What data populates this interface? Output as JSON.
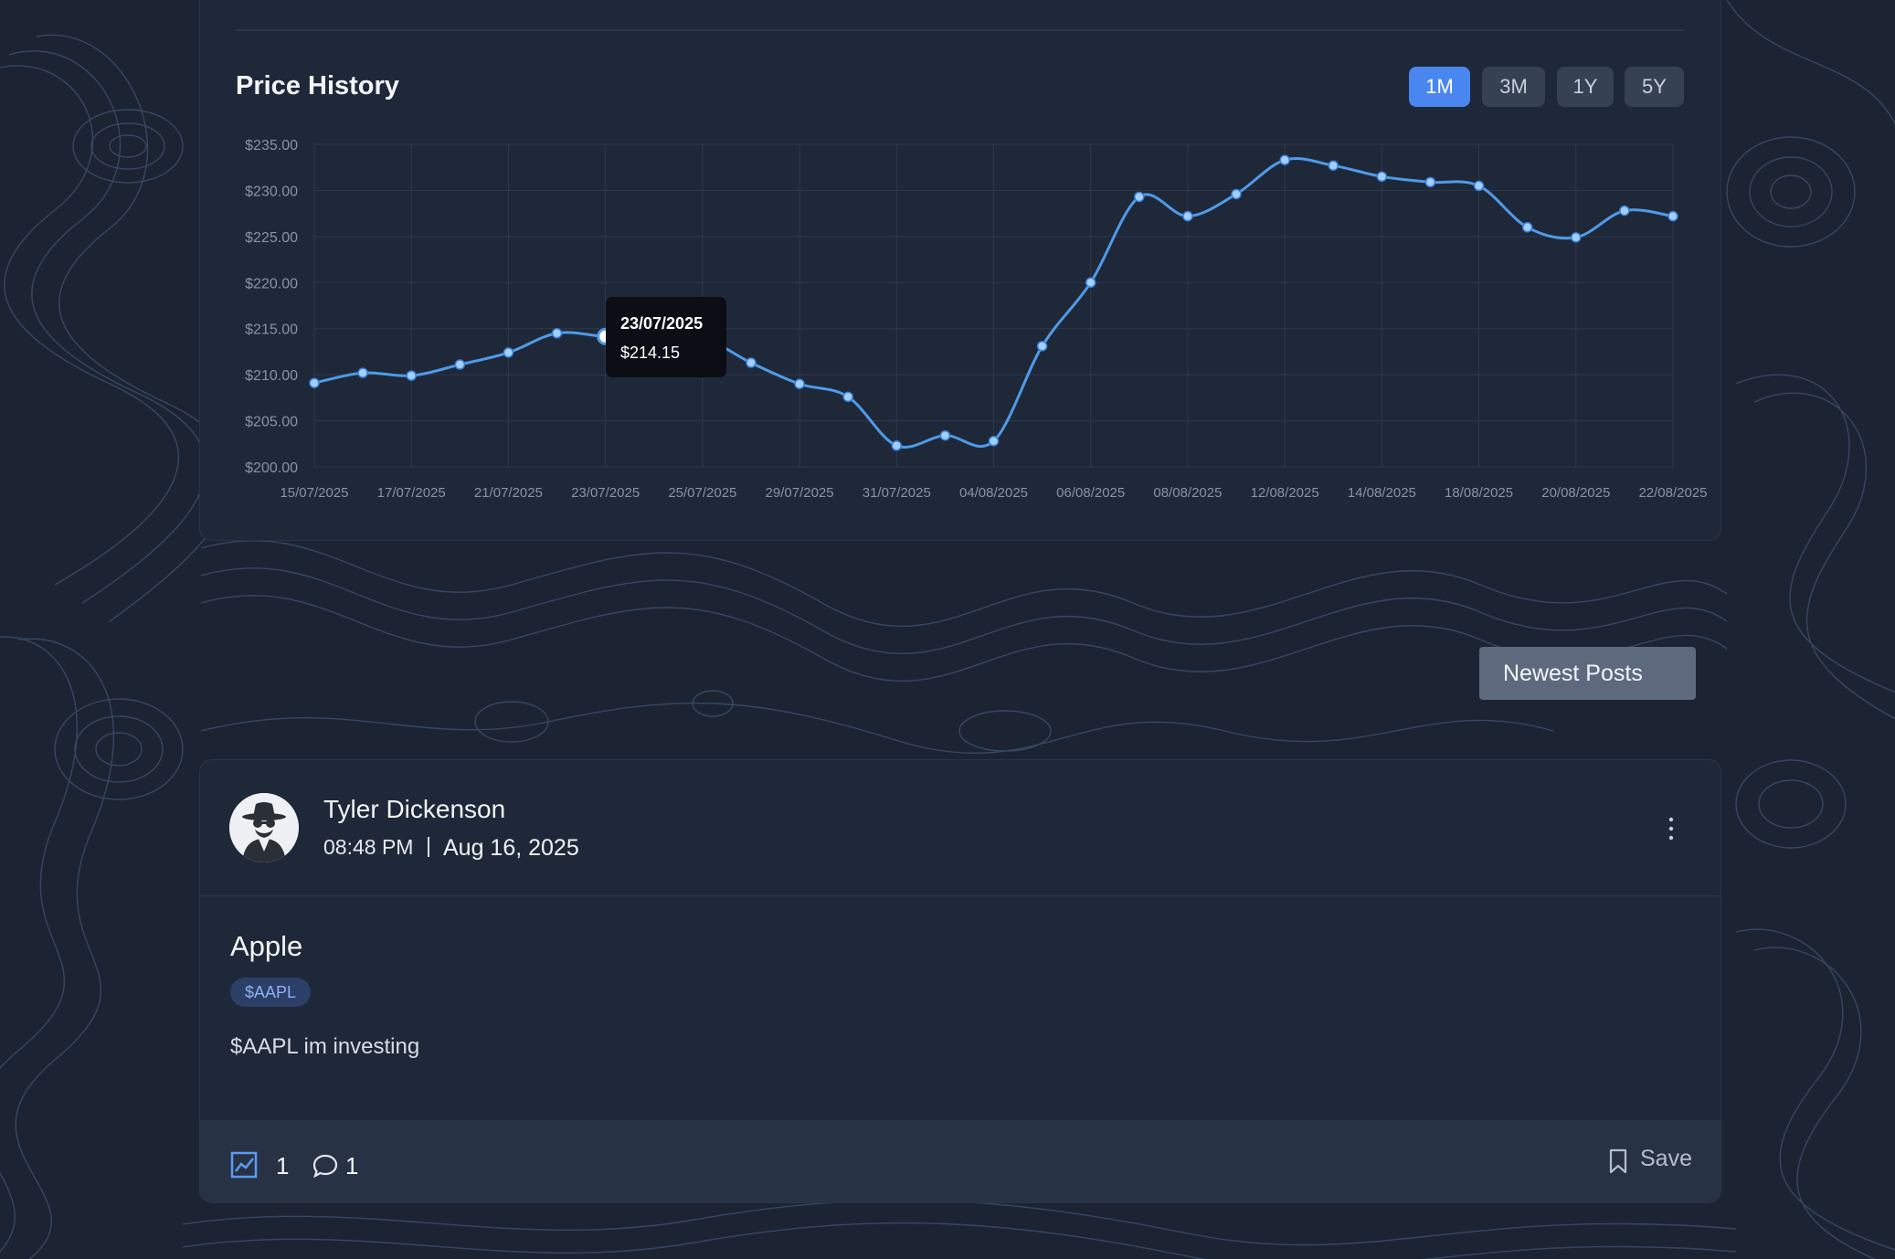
{
  "chart_card": {
    "title": "Price History",
    "ranges": [
      "1M",
      "3M",
      "1Y",
      "5Y"
    ],
    "active_range": "1M",
    "tooltip": {
      "date": "23/07/2025",
      "price": "$214.15"
    }
  },
  "chart_data": {
    "type": "line",
    "y_ticks": [
      "$235.00",
      "$230.00",
      "$225.00",
      "$220.00",
      "$215.00",
      "$210.00",
      "$205.00",
      "$200.00"
    ],
    "x_tick_labels": [
      "15/07/2025",
      "17/07/2025",
      "21/07/2025",
      "23/07/2025",
      "25/07/2025",
      "29/07/2025",
      "31/07/2025",
      "04/08/2025",
      "06/08/2025",
      "08/08/2025",
      "12/08/2025",
      "14/08/2025",
      "18/08/2025",
      "20/08/2025",
      "22/08/2025"
    ],
    "ylim": [
      200,
      235
    ],
    "values": [
      209.1,
      210.2,
      209.9,
      211.1,
      212.4,
      214.5,
      214.15,
      214.0,
      214.0,
      211.3,
      209.0,
      207.6,
      202.3,
      203.4,
      202.8,
      213.1,
      220.0,
      229.3,
      227.2,
      229.6,
      233.3,
      232.7,
      231.5,
      230.9,
      230.5,
      226.0,
      224.9,
      227.8,
      227.2
    ],
    "line_color": "#4f9be8",
    "grid": true
  },
  "sort_button": {
    "label": "Newest Posts"
  },
  "post": {
    "author": "Tyler Dickenson",
    "time": "08:48 PM",
    "separator": "|",
    "date": "Aug 16, 2025",
    "title": "Apple",
    "ticker": "$AAPL",
    "body": "$AAPL im investing",
    "chart_count": "1",
    "comment_count": "1",
    "save_label": "Save"
  },
  "icons": [
    "kebab-menu-icon",
    "trend-chart-icon",
    "comment-bubble-icon",
    "bookmark-icon",
    "incognito-avatar-icon"
  ],
  "colors": {
    "accent": "#4a86f0",
    "card": "#1f2839",
    "background": "#1c2433"
  }
}
